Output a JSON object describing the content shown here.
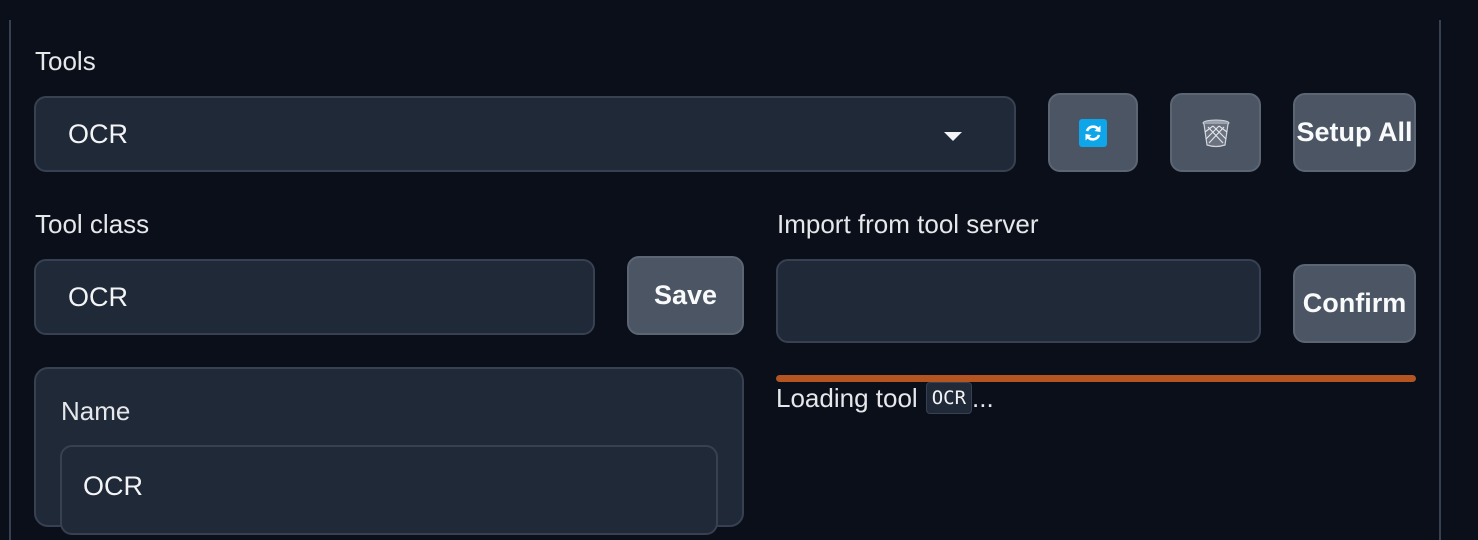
{
  "tools": {
    "label": "Tools",
    "selected": "OCR",
    "refresh_icon": "refresh-icon",
    "delete_icon": "trash-icon",
    "setup_all_label": "Setup All"
  },
  "tool_class": {
    "label": "Tool class",
    "value": "OCR",
    "save_label": "Save"
  },
  "import_server": {
    "label": "Import from tool server",
    "value": "",
    "confirm_label": "Confirm"
  },
  "name_panel": {
    "label": "Name",
    "value": "OCR"
  },
  "status": {
    "prefix": "Loading tool",
    "tool": "OCR",
    "suffix": "...",
    "progress": 1.0
  },
  "colors": {
    "background": "#0b0f19",
    "field": "#1f2937",
    "button": "#4b5563",
    "progress": "#b45521",
    "refresh_icon": "#0ea5e9"
  }
}
